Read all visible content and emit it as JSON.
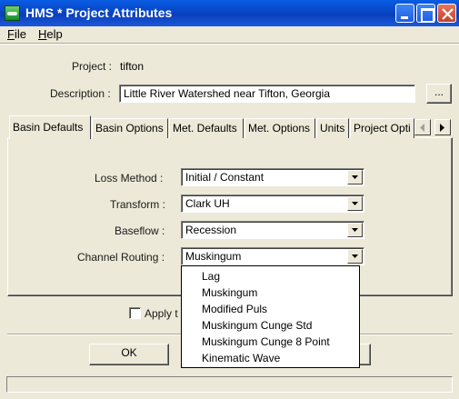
{
  "window": {
    "title": "HMS * Project Attributes"
  },
  "menu": {
    "file": "File",
    "file_u": "F",
    "file_rest": "ile",
    "help_u": "H",
    "help_rest": "elp"
  },
  "project": {
    "project_label": "Project :",
    "project_value": "tifton",
    "description_label": "Description :",
    "description_value": "Little River Watershed near Tifton, Georgia",
    "browse_label": "..."
  },
  "tabs": [
    {
      "label": "Basin Defaults",
      "active": true
    },
    {
      "label": "Basin Options"
    },
    {
      "label": "Met. Defaults"
    },
    {
      "label": "Met. Options"
    },
    {
      "label": "Units"
    },
    {
      "label": "Project Opti"
    }
  ],
  "basin_defaults": {
    "loss_label": "Loss Method :",
    "loss_value": "Initial / Constant",
    "transform_label": "Transform :",
    "transform_value": "Clark UH",
    "baseflow_label": "Baseflow :",
    "baseflow_value": "Recession",
    "routing_label": "Channel Routing :",
    "routing_value": "Muskingum"
  },
  "routing_options": [
    "Lag",
    "Muskingum",
    "Modified Puls",
    "Muskingum Cunge Std",
    "Muskingum Cunge 8 Point",
    "Kinematic Wave"
  ],
  "apply_checkbox_label": "Apply t",
  "buttons": {
    "ok": "OK"
  },
  "icons": {
    "app": "hms-app-icon",
    "minimize": "minimize-icon",
    "maximize": "maximize-icon",
    "close": "close-icon",
    "tab_left": "arrow-left-icon",
    "tab_right": "arrow-right-icon",
    "combo": "chevron-down-icon"
  }
}
